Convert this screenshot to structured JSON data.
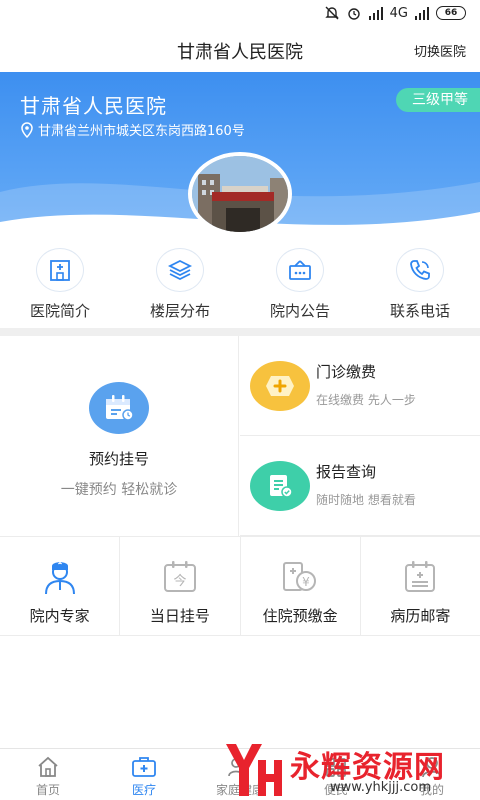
{
  "status_bar": {
    "network": "4G",
    "battery": "66"
  },
  "header": {
    "title": "甘肃省人民医院",
    "switch_label": "切换医院"
  },
  "hospital": {
    "name": "甘肃省人民医院",
    "grade": "三级甲等",
    "address": "甘肃省兰州市城关区东岗西路160号",
    "photo_sign": "甘 肃 省 人 民 医 院"
  },
  "quick_links": [
    {
      "label": "医院简介",
      "icon": "hospital-building-icon"
    },
    {
      "label": "楼层分布",
      "icon": "layers-icon"
    },
    {
      "label": "院内公告",
      "icon": "notice-board-icon"
    },
    {
      "label": "联系电话",
      "icon": "phone-icon"
    }
  ],
  "main_services": {
    "appointment": {
      "title": "预约挂号",
      "subtitle": "一键预约 轻松就诊",
      "icon": "calendar-icon"
    },
    "payment": {
      "title": "门诊缴费",
      "subtitle": "在线缴费 先人一步",
      "icon": "plus-icon"
    },
    "report": {
      "title": "报告查询",
      "subtitle": "随时随地 想看就看",
      "icon": "report-icon"
    }
  },
  "services": [
    {
      "label": "院内专家",
      "icon": "doctor-icon"
    },
    {
      "label": "当日挂号",
      "icon": "today-calendar-icon",
      "glyph": "今"
    },
    {
      "label": "住院预缴金",
      "icon": "deposit-icon",
      "glyph": "¥"
    },
    {
      "label": "病历邮寄",
      "icon": "medical-record-icon"
    }
  ],
  "tabbar": [
    {
      "label": "首页",
      "icon": "home-icon",
      "active": false
    },
    {
      "label": "医疗",
      "icon": "medical-kit-icon",
      "active": true
    },
    {
      "label": "家庭健康",
      "icon": "family-icon",
      "active": false
    },
    {
      "label": "便民",
      "icon": "convenience-icon",
      "active": false
    },
    {
      "label": "我的",
      "icon": "user-icon",
      "active": false
    }
  ],
  "watermark": {
    "text": "永辉资源网",
    "url": "www.yhkjjj.com"
  },
  "colors": {
    "primary": "#2f86f0",
    "badge": "#4fd6b4",
    "payment": "#f7c23e",
    "report": "#3ecfa9",
    "watermark": "#e8232d"
  }
}
